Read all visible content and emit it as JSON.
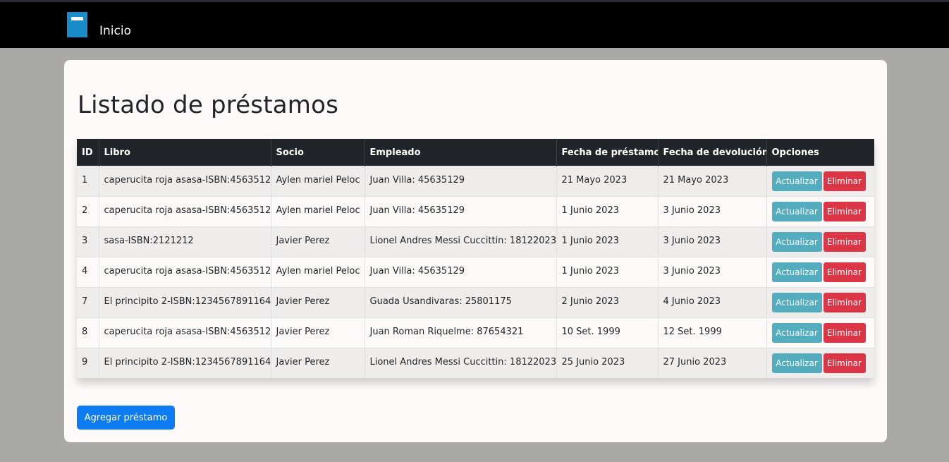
{
  "navbar": {
    "brand": "Inicio",
    "logo_icon": "book-icon",
    "logo_color": "#1a8ccc"
  },
  "page": {
    "title": "Listado de préstamos"
  },
  "table": {
    "headers": [
      "ID",
      "Libro",
      "Socio",
      "Empleado",
      "Fecha de préstamo",
      "Fecha de devolución",
      "Opciones"
    ],
    "rows": [
      {
        "id": "1",
        "libro": "caperucita roja asasa-ISBN:4563512",
        "socio": "Aylen mariel Peloc",
        "empleado": "Juan Villa: 45635129",
        "prestamo": "21 Mayo 2023",
        "devolucion": "21 Mayo 2023"
      },
      {
        "id": "2",
        "libro": "caperucita roja asasa-ISBN:4563512",
        "socio": "Aylen mariel Peloc",
        "empleado": "Juan Villa: 45635129",
        "prestamo": "1 Junio 2023",
        "devolucion": "3 Junio 2023"
      },
      {
        "id": "3",
        "libro": "sasa-ISBN:2121212",
        "socio": "Javier Perez",
        "empleado": "Lionel Andres Messi Cuccittin: 18122023",
        "prestamo": "1 Junio 2023",
        "devolucion": "3 Junio 2023"
      },
      {
        "id": "4",
        "libro": "caperucita roja asasa-ISBN:4563512",
        "socio": "Aylen mariel Peloc",
        "empleado": "Juan Villa: 45635129",
        "prestamo": "1 Junio 2023",
        "devolucion": "3 Junio 2023"
      },
      {
        "id": "7",
        "libro": "El principito 2-ISBN:1234567891164",
        "socio": "Javier Perez",
        "empleado": "Guada Usandivaras: 25801175",
        "prestamo": "2 Junio 2023",
        "devolucion": "4 Junio 2023"
      },
      {
        "id": "8",
        "libro": "caperucita roja asasa-ISBN:4563512",
        "socio": "Javier Perez",
        "empleado": "Juan Roman Riquelme: 87654321",
        "prestamo": "10 Set. 1999",
        "devolucion": "12 Set. 1999"
      },
      {
        "id": "9",
        "libro": "El principito 2-ISBN:1234567891164",
        "socio": "Javier Perez",
        "empleado": "Lionel Andres Messi Cuccittin: 18122023",
        "prestamo": "25 Junio 2023",
        "devolucion": "27 Junio 2023"
      }
    ],
    "update_label": "Actualizar",
    "delete_label": "Eliminar"
  },
  "actions": {
    "add_label": "Agregar préstamo"
  },
  "colors": {
    "navbar": "#000000",
    "background": "#a9a9a7",
    "card": "#fcf9f8",
    "table_header": "#212529",
    "update_button": "#53adbf",
    "delete_button": "#dc3545",
    "primary_button": "#0d7cf2"
  }
}
